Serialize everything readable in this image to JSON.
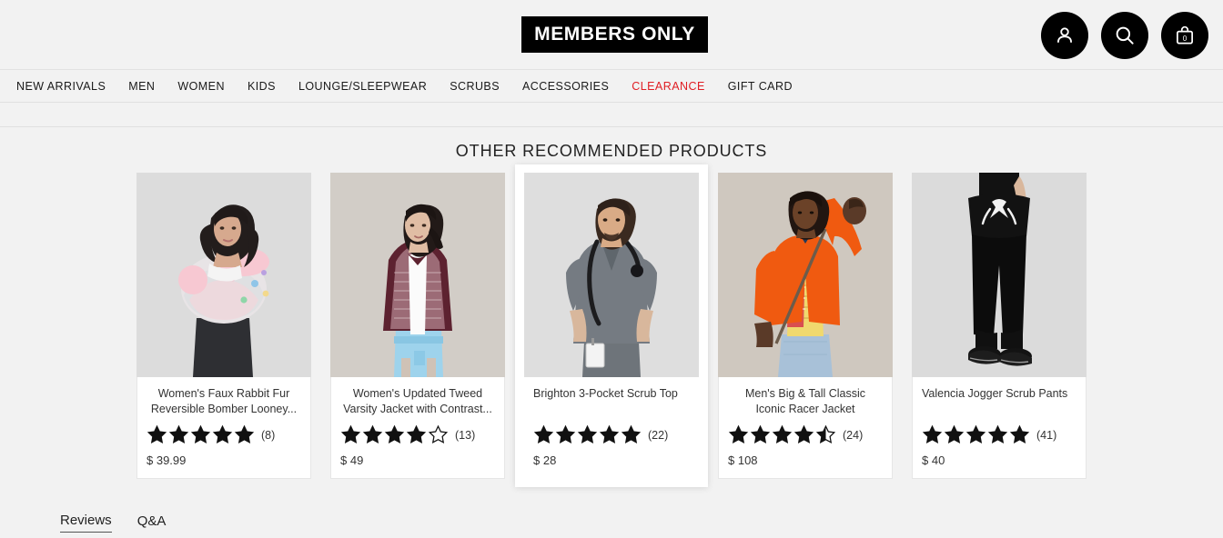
{
  "header": {
    "logo": "MEMBERS ONLY",
    "icons": [
      {
        "name": "account-icon",
        "label": "Account"
      },
      {
        "name": "search-icon",
        "label": "Search"
      },
      {
        "name": "cart-icon",
        "label": "Cart",
        "count": "0"
      }
    ]
  },
  "nav": {
    "items": [
      {
        "label": "NEW ARRIVALS",
        "accent": false
      },
      {
        "label": "MEN",
        "accent": false
      },
      {
        "label": "WOMEN",
        "accent": false
      },
      {
        "label": "KIDS",
        "accent": false
      },
      {
        "label": "LOUNGE/SLEEPWEAR",
        "accent": false
      },
      {
        "label": "SCRUBS",
        "accent": false
      },
      {
        "label": "ACCESSORIES",
        "accent": false
      },
      {
        "label": "CLEARANCE",
        "accent": true
      },
      {
        "label": "GIFT CARD",
        "accent": false
      }
    ],
    "accent_color": "#e01e24"
  },
  "main": {
    "section_title": "OTHER RECOMMENDED PRODUCTS",
    "products": [
      {
        "title": "Women's Faux Rabbit Fur Reversible Bomber Looney...",
        "rating": 5,
        "review_count": "(8)",
        "price": "$ 39.99",
        "featured": false,
        "title_align": "center"
      },
      {
        "title": "Women's Updated Tweed Varsity Jacket with Contrast...",
        "rating": 4,
        "review_count": "(13)",
        "price": "$ 49",
        "featured": false,
        "title_align": "center"
      },
      {
        "title": "Brighton 3-Pocket Scrub Top",
        "rating": 5,
        "review_count": "(22)",
        "price": "$ 28",
        "featured": true,
        "title_align": "left"
      },
      {
        "title": "Men's Big & Tall Classic Iconic Racer Jacket",
        "rating": 4.5,
        "review_count": "(24)",
        "price": "$ 108",
        "featured": false,
        "title_align": "center"
      },
      {
        "title": "Valencia Jogger Scrub Pants",
        "rating": 5,
        "review_count": "(41)",
        "price": "$ 40",
        "featured": false,
        "title_align": "left"
      }
    ]
  },
  "tabs": [
    {
      "label": "Reviews",
      "active": true
    },
    {
      "label": "Q&A",
      "active": false
    }
  ]
}
